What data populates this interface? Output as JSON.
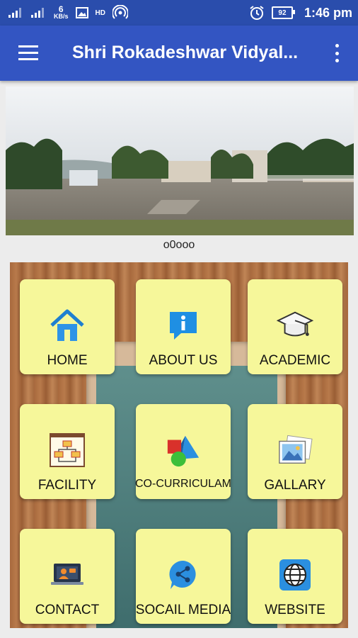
{
  "status_bar": {
    "net_speed_value": "6",
    "net_speed_unit": "KB/s",
    "network_type": "HD",
    "battery_level": "92",
    "time": "1:46 pm"
  },
  "app_bar": {
    "title": "Shri Rokadeshwar Vidyal..."
  },
  "slider": {
    "indicator": "o0ooo"
  },
  "menu": {
    "items": [
      {
        "label": "HOME",
        "icon": "home-icon"
      },
      {
        "label": "ABOUT US",
        "icon": "info-icon"
      },
      {
        "label": "ACADEMIC",
        "icon": "graduation-cap-icon"
      },
      {
        "label": "FACILITY",
        "icon": "flowchart-icon"
      },
      {
        "label": "CO-CURRICULAM",
        "icon": "shapes-icon"
      },
      {
        "label": "GALLARY",
        "icon": "photos-icon"
      },
      {
        "label": "CONTACT",
        "icon": "video-call-icon"
      },
      {
        "label": "SOCAIL MEDIA",
        "icon": "share-icon"
      },
      {
        "label": "WEBSITE",
        "icon": "globe-icon"
      }
    ]
  },
  "colors": {
    "status_bar": "#2a4dac",
    "app_bar": "#3355c2",
    "tile": "#f6f79a"
  }
}
